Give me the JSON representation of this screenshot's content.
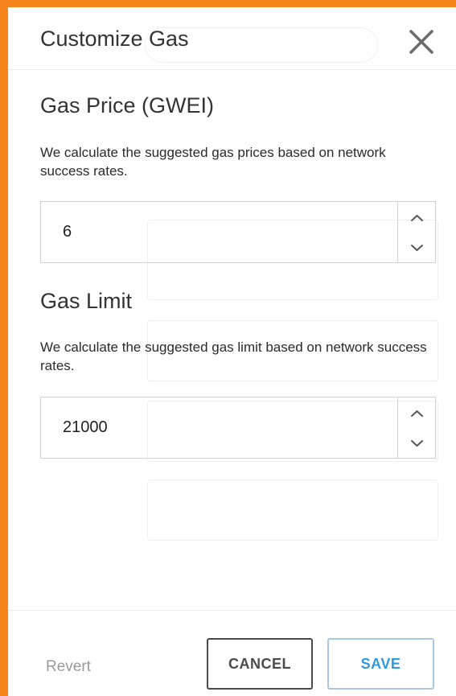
{
  "modal": {
    "title": "Customize Gas"
  },
  "gas_price": {
    "title": "Gas Price (GWEI)",
    "description": "We calculate the suggested gas prices based on network success rates.",
    "value": "6"
  },
  "gas_limit": {
    "title": "Gas Limit",
    "description": "We calculate the suggested gas limit based on network success rates.",
    "value": "21000"
  },
  "footer": {
    "revert_label": "Revert",
    "cancel_label": "CANCEL",
    "save_label": "SAVE"
  },
  "colors": {
    "accent": "#f6851b",
    "save_text": "#2f9ae0",
    "save_border": "#a9c7e8",
    "cancel_border": "#4a4a4a"
  },
  "icons": {
    "close": "close-icon",
    "stepper_up": "chevron-up-icon",
    "stepper_down": "chevron-down-icon"
  }
}
